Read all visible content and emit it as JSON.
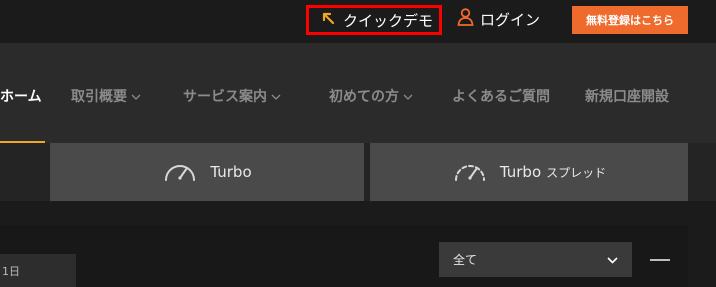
{
  "header": {
    "demo_label": "クイックデモ",
    "login_label": "ログイン",
    "register_label": "無料登録はこちら",
    "icons": {
      "demo": "arrow-up-left-icon",
      "login": "user-icon"
    },
    "colors": {
      "demo_arrow": "#f0a824",
      "login_icon": "#ef6a2d",
      "register_bg": "#ef6a2d",
      "highlight_border": "#ff0000"
    }
  },
  "nav": {
    "items": [
      {
        "label": "ホーム",
        "active": true
      },
      {
        "label": "取引概要",
        "dropdown": true
      },
      {
        "label": "サービス案内",
        "dropdown": true
      },
      {
        "label": "初めての方",
        "dropdown": true
      },
      {
        "label": "よくあるご質問"
      },
      {
        "label": "新規口座開設"
      }
    ],
    "active_underline_color": "#f0a824"
  },
  "tabs": [
    {
      "label": "Turbo",
      "suffix": "",
      "icon": "speedometer-icon"
    },
    {
      "label": "Turbo",
      "suffix": "スプレッド",
      "icon": "speedometer-dashed-icon"
    }
  ],
  "filter": {
    "date_partial": "1日",
    "select_value": "全て",
    "select_icon": "chevron-down-icon",
    "minus_icon": "minus-icon"
  }
}
